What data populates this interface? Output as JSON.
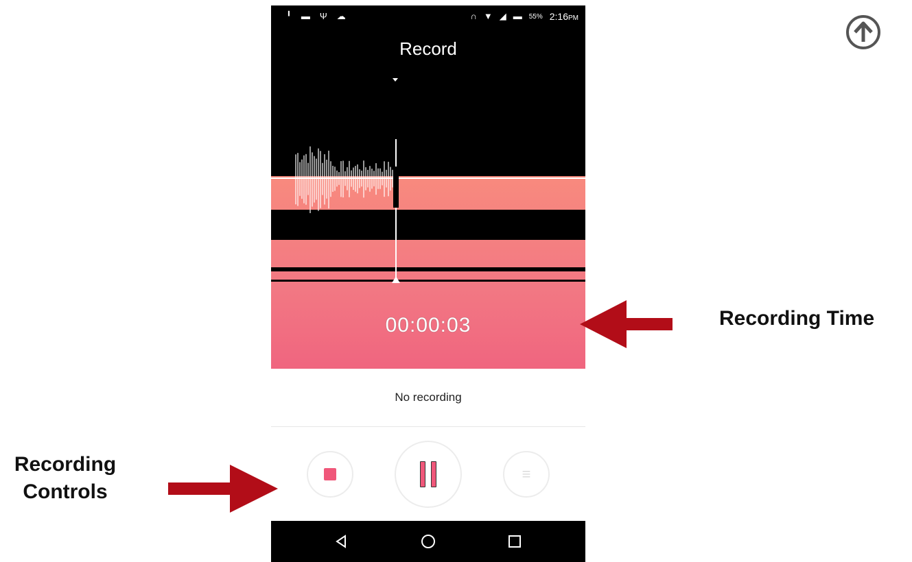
{
  "status_bar": {
    "battery_pct": "55%",
    "time": "2:16",
    "time_suffix": "PM"
  },
  "screen": {
    "title": "Record",
    "timer": "00:00:03",
    "status": "No recording"
  },
  "controls": {
    "stop": "stop-icon",
    "pause": "pause-icon",
    "list": "list-icon",
    "list_glyph": "≡"
  },
  "annotations": {
    "recording_time": "Recording Time",
    "recording_controls_line1": "Recording",
    "recording_controls_line2": "Controls"
  },
  "colors": {
    "accent": "#f0577a",
    "arrow": "#b20d18",
    "gradient_top": "#f88a7e",
    "gradient_bottom": "#f0657f"
  }
}
